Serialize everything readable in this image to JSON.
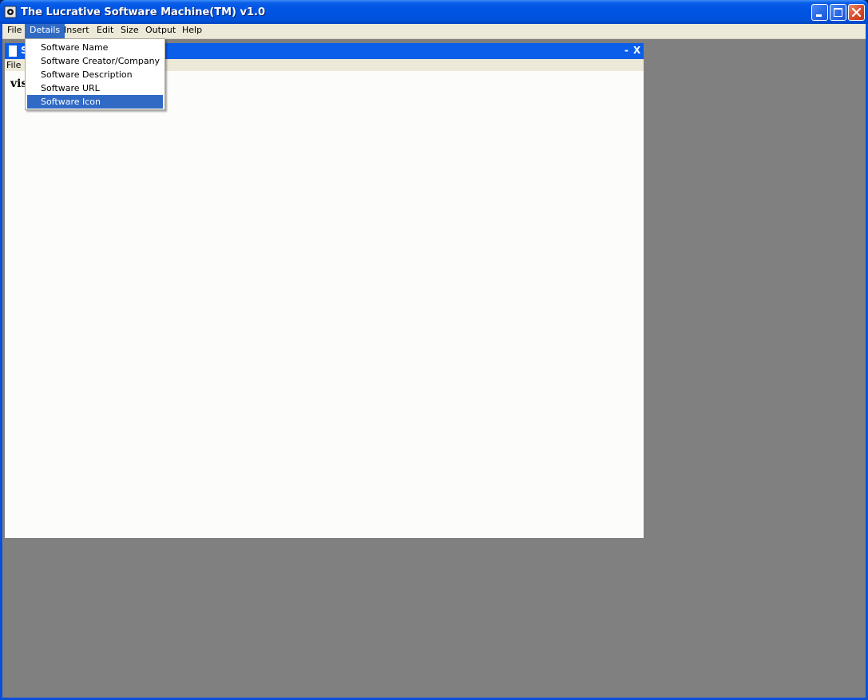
{
  "window": {
    "title": "The Lucrative Software Machine(TM) v1.0"
  },
  "menubar": {
    "items": [
      {
        "label": "File"
      },
      {
        "label": "Details"
      },
      {
        "label": "Insert"
      },
      {
        "label": "Edit"
      },
      {
        "label": "Size"
      },
      {
        "label": "Output"
      },
      {
        "label": "Help"
      }
    ]
  },
  "details_menu": {
    "items": [
      {
        "label": "Software Name"
      },
      {
        "label": "Software Creator/Company"
      },
      {
        "label": "Software Description"
      },
      {
        "label": "Software URL"
      },
      {
        "label": "Software Icon"
      }
    ],
    "highlighted": "Software Icon"
  },
  "child_window": {
    "title_visible": "S",
    "min_label": "-",
    "close_label": "X",
    "menu": {
      "file_label": "File"
    },
    "content_text": "vis"
  },
  "colors": {
    "accent": "#316ac5",
    "titlebar": "#0054e3",
    "workspace": "#808080"
  }
}
